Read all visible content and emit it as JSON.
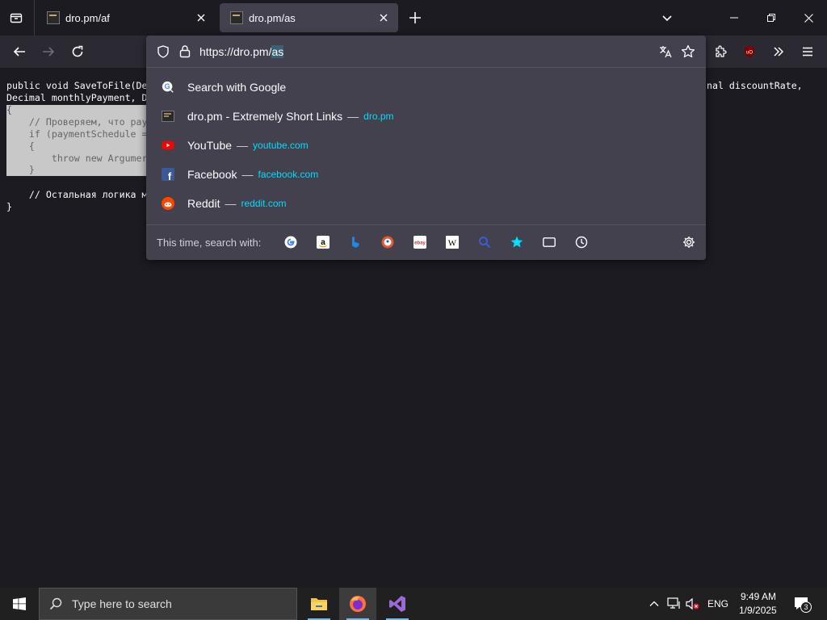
{
  "tabs": [
    {
      "title": "dro.pm/af",
      "active": false
    },
    {
      "title": "dro.pm/as",
      "active": true
    }
  ],
  "urlbar": {
    "prefix": "https://dro.pm/",
    "selected": "as"
  },
  "code": {
    "line1": "public void SaveToFile(De",
    "line1_right": "nal discountRate,",
    "line2": "Decimal monthlyPayment, D",
    "line3": "{",
    "line4": "    // Проверяем, что pay",
    "line5": "    if (paymentSchedule =",
    "line6": "    {",
    "line7": "        throw new Argumer",
    "line8": "    }",
    "line9": "    // Остальная логика м",
    "line10": "}"
  },
  "suggestions": [
    {
      "icon": "google-search-icon",
      "title": "Search with Google",
      "dash": "",
      "url": ""
    },
    {
      "icon": "dro-pm-favicon",
      "title": "dro.pm - Extremely Short Links",
      "dash": "—",
      "url": "dro.pm"
    },
    {
      "icon": "youtube-icon",
      "title": "YouTube",
      "dash": "—",
      "url": "youtube.com"
    },
    {
      "icon": "facebook-icon",
      "title": "Facebook",
      "dash": "—",
      "url": "facebook.com"
    },
    {
      "icon": "reddit-icon",
      "title": "Reddit",
      "dash": "—",
      "url": "reddit.com"
    }
  ],
  "search_with": {
    "label": "This time, search with:",
    "engines": [
      "google-icon",
      "amazon-icon",
      "bing-icon",
      "duckduckgo-icon",
      "ebay-icon",
      "wikipedia-icon",
      "search-icon",
      "bookmarks-star-icon",
      "tabs-icon",
      "history-icon"
    ]
  },
  "taskbar": {
    "search_placeholder": "Type here to search",
    "lang": "ENG",
    "time": "9:49 AM",
    "date": "1/9/2025",
    "notification_count": "3"
  },
  "colors": {
    "accent": "#00ddff",
    "popup_bg": "#42414d",
    "toolbar_bg": "#2b2a33",
    "page_bg": "#1c1b22",
    "selection": "#c8c8c8"
  }
}
